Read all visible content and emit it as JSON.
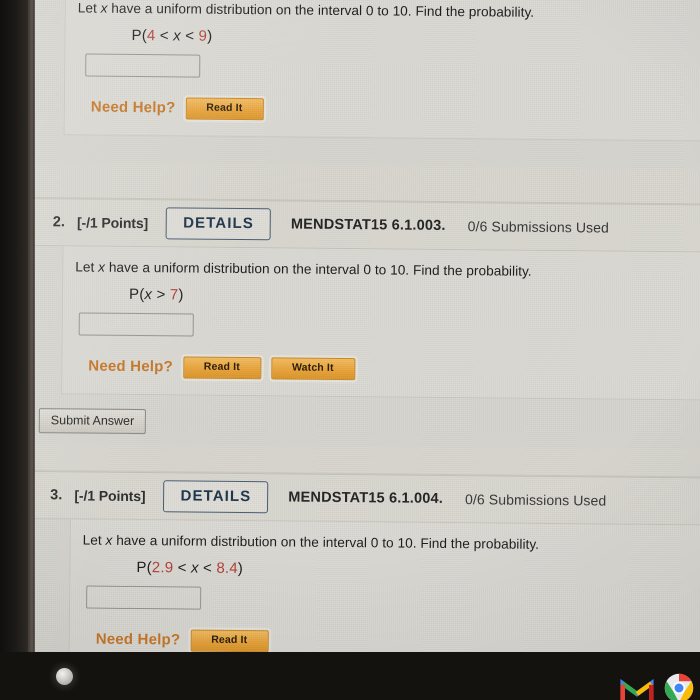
{
  "app": {
    "platform": "WebAssign homework page (photo of laptop screen)"
  },
  "taskbar": {
    "home_icon": "home-circle-icon",
    "icons": [
      {
        "name": "gmail-icon",
        "label": "Gmail"
      },
      {
        "name": "chrome-icon",
        "label": "Chrome"
      }
    ]
  },
  "questions": [
    {
      "number": "",
      "points": "",
      "details_label": "",
      "code": "",
      "submissions": "",
      "prompt_pre": "Let ",
      "prompt_var": "x",
      "prompt_post": " have a uniform distribution on the interval 0 to 10. Find the probability.",
      "expr": {
        "open": "P(",
        "lower": "4",
        "op1": " < ",
        "var": "x",
        "op2": " < ",
        "upper": "9",
        "close": ")"
      },
      "answer_value": "",
      "need_help_label": "Need Help?",
      "help_buttons": [
        {
          "label": "Read It"
        }
      ],
      "submit_label": ""
    },
    {
      "number": "2.",
      "points": "[-/1 Points]",
      "details_label": "DETAILS",
      "code": "MENDSTAT15 6.1.003.",
      "submissions": "0/6 Submissions Used",
      "prompt_pre": "Let ",
      "prompt_var": "x",
      "prompt_post": " have a uniform distribution on the interval 0 to 10. Find the probability.",
      "expr": {
        "open": "P(",
        "lower": "",
        "op1": "",
        "var": "x",
        "op2": " > ",
        "upper": "7",
        "close": ")"
      },
      "answer_value": "",
      "need_help_label": "Need Help?",
      "help_buttons": [
        {
          "label": "Read It"
        },
        {
          "label": "Watch It"
        }
      ],
      "submit_label": "Submit Answer"
    },
    {
      "number": "3.",
      "points": "[-/1 Points]",
      "details_label": "DETAILS",
      "code": "MENDSTAT15 6.1.004.",
      "submissions": "0/6 Submissions Used",
      "prompt_pre": "Let ",
      "prompt_var": "x",
      "prompt_post": " have a uniform distribution on the interval 0 to 10. Find the probability.",
      "expr": {
        "open": "P(",
        "lower": "2.9",
        "op1": " < ",
        "var": "x",
        "op2": " < ",
        "upper": "8.4",
        "close": ")"
      },
      "answer_value": "",
      "need_help_label": "Need Help?",
      "help_buttons": [
        {
          "label": "Read It"
        }
      ],
      "submit_label": ""
    }
  ],
  "colors": {
    "page_bg": "#dedcd6",
    "header_bg": "#dcdad3",
    "details_border": "#4d5f77",
    "details_text": "#21374f",
    "need_help_orange": "#c97a2a",
    "help_button_gold": "#eca740",
    "expr_number_red": "#b4433c",
    "bezel": "#15130f"
  }
}
